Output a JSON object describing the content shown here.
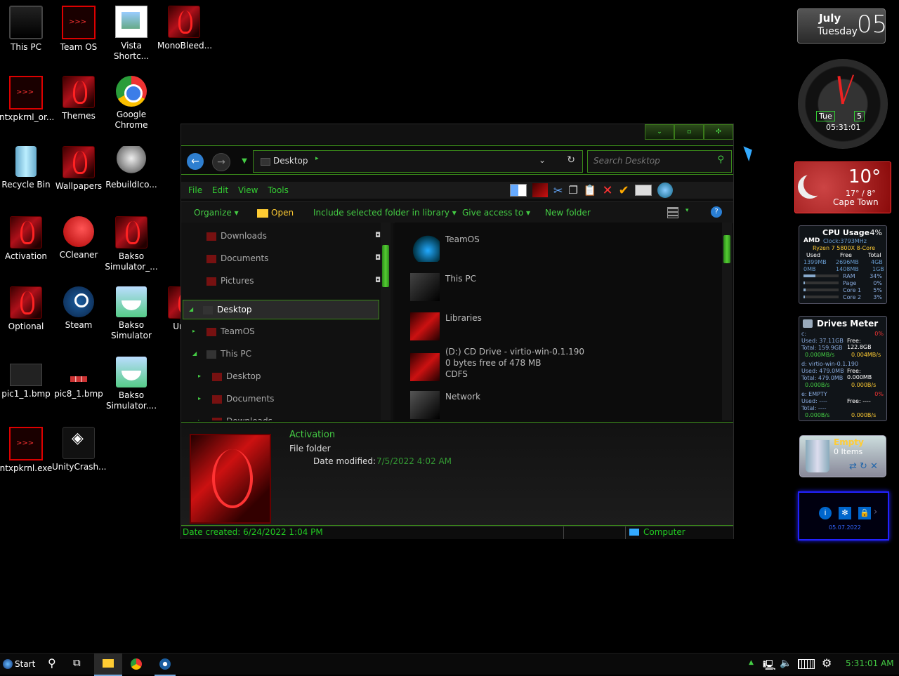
{
  "desktop_icons": [
    {
      "label": "This PC",
      "icon": "monitor-icon"
    },
    {
      "label": "Team OS",
      "icon": "teamos-icon"
    },
    {
      "label": "Vista Shortc...",
      "icon": "vista-shortcut-icon"
    },
    {
      "label": "MonoBleed...",
      "icon": "alien-folder-icon"
    },
    {
      "label": "ntxpkrnl_or...",
      "icon": "red-app-icon"
    },
    {
      "label": "Themes",
      "icon": "alien-folder-icon"
    },
    {
      "label": "Google Chrome",
      "icon": "chrome-icon"
    },
    {
      "label": "Recycle Bin",
      "icon": "recycle-bin-icon"
    },
    {
      "label": "Wallpapers",
      "icon": "alien-folder-icon"
    },
    {
      "label": "RebuildIco...",
      "icon": "robot-icon"
    },
    {
      "label": "Activation",
      "icon": "alien-folder-icon"
    },
    {
      "label": "CCleaner",
      "icon": "ccleaner-icon"
    },
    {
      "label": "Bakso Simulator_...",
      "icon": "alien-folder-icon"
    },
    {
      "label": "Optional",
      "icon": "alien-folder-icon"
    },
    {
      "label": "Steam",
      "icon": "steam-icon"
    },
    {
      "label": "Bakso Simulator",
      "icon": "bakso-icon"
    },
    {
      "label": "Unity",
      "icon": "alien-folder-icon"
    },
    {
      "label": "pic1_1.bmp",
      "icon": "image-file-icon"
    },
    {
      "label": "pic8_1.bmp",
      "icon": "image-file-icon"
    },
    {
      "label": "Bakso Simulator....",
      "icon": "bakso-icon"
    },
    {
      "label": "ntxpkrnl.exe",
      "icon": "red-app-icon"
    },
    {
      "label": "UnityCrash...",
      "icon": "unity-icon"
    }
  ],
  "explorer": {
    "address": "Desktop",
    "search_placeholder": "Search Desktop",
    "menu": [
      "File",
      "Edit",
      "View",
      "Tools"
    ],
    "commands": {
      "organize": "Organize",
      "open": "Open",
      "include": "Include selected folder in library",
      "give_access": "Give access to",
      "new_folder": "New folder"
    },
    "nav_items": [
      {
        "label": "Downloads",
        "pinned": true
      },
      {
        "label": "Documents",
        "pinned": true
      },
      {
        "label": "Pictures",
        "pinned": true
      },
      {
        "label": "Desktop",
        "selected": true
      },
      {
        "label": "TeamOS"
      },
      {
        "label": "This PC"
      },
      {
        "label": "Desktop"
      },
      {
        "label": "Documents"
      },
      {
        "label": "Downloads"
      }
    ],
    "content_items": [
      {
        "name": "TeamOS",
        "line2": "",
        "line3": ""
      },
      {
        "name": "This PC",
        "line2": "",
        "line3": ""
      },
      {
        "name": "Libraries",
        "line2": "",
        "line3": ""
      },
      {
        "name": "(D:) CD Drive - virtio-win-0.1.190",
        "line2": "0 bytes free of 478 MB",
        "line3": "CDFS"
      },
      {
        "name": "Network",
        "line2": "",
        "line3": ""
      }
    ],
    "details": {
      "name": "Activation",
      "type": "File folder",
      "modified_label": "Date modified:",
      "modified_value": "7/5/2022 4:02 AM"
    },
    "status": {
      "created": "Date created: 6/24/2022 1:04 PM",
      "location": "Computer"
    }
  },
  "calendar": {
    "month": "July",
    "weekday": "Tuesday",
    "day": "05"
  },
  "clock": {
    "day_short": "Tue",
    "day_num": "5",
    "time": "05:31:01"
  },
  "weather": {
    "temp": "10°",
    "range": "17° / 8°",
    "city": "Cape Town"
  },
  "cpu": {
    "title": "CPU Usage",
    "percent": "4%",
    "brand": "AMD",
    "clock": "Clock:3793MHz",
    "model": "Ryzen 7 5800X 8-Core",
    "headers": [
      "Used",
      "Free",
      "Total"
    ],
    "row1": [
      "1399MB",
      "2696MB",
      "4GB"
    ],
    "row2": [
      "0MB",
      "1408MB",
      "1GB"
    ],
    "bars": [
      {
        "label": "RAM",
        "value": "34%"
      },
      {
        "label": "Page",
        "value": "0%"
      },
      {
        "label": "Core 1",
        "value": "5%"
      },
      {
        "label": "Core 2",
        "value": "3%"
      }
    ]
  },
  "drives": {
    "title": "Drives Meter",
    "c": {
      "label": "c:",
      "pct": "0%",
      "used": "Used: 37.11GB",
      "free": "Free: 122.8GB",
      "total": "Total: 159.9GB",
      "up": "0.000MB/s",
      "down": "0.004MB/s"
    },
    "d": {
      "label": "d: virtio-win-0.1.190",
      "used": "Used: 479.0MB",
      "free": "Free: 0.000MB",
      "total": "Total: 479.0MB",
      "up": "0.000B/s",
      "down": "0.000B/s"
    },
    "e": {
      "label": "e: EMPTY",
      "pct": "0%",
      "used": "Used: ----",
      "free": "Free: ----",
      "total": "Total: ----",
      "up": "0.000B/s",
      "down": "0.000B/s"
    }
  },
  "recycle": {
    "status": "Empty",
    "items": "0 Items"
  },
  "date_gadget": {
    "date": "05.07.2022"
  },
  "taskbar": {
    "start": "Start",
    "time": "5:31:01 AM"
  },
  "colors": {
    "accent_green": "#3a8a1a",
    "text_green": "#33cc33",
    "alien_red": "#cc1122"
  }
}
